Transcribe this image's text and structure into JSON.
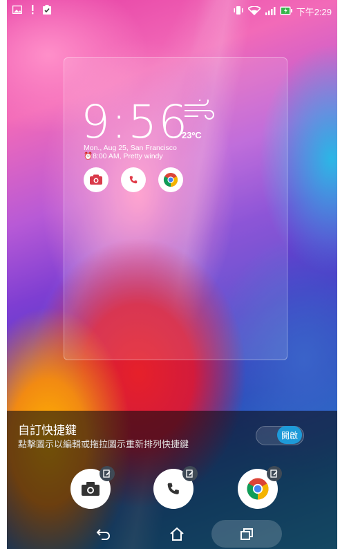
{
  "status_bar": {
    "left_icons": [
      "image-notification-icon",
      "alert-icon",
      "clipboard-check-icon"
    ],
    "right_icons": [
      "vibrate-icon",
      "wifi-icon",
      "signal-icon",
      "battery-charging-icon"
    ],
    "time": "下午2:29"
  },
  "widget": {
    "time": "9:56",
    "temperature": "23ºC",
    "date_line": "Mon., Aug 25, San Francisco",
    "alarm_line": "8:00 AM, Pretty windy",
    "weather_icon": "windy-icon",
    "apps": [
      "camera-icon",
      "phone-icon",
      "chrome-icon"
    ]
  },
  "panel": {
    "title": "自訂快捷鍵",
    "subtitle": "點擊圖示以編輯或拖拉圖示重新排列快捷鍵",
    "toggle_label": "開啟",
    "toggle_state": "on",
    "shortcuts": [
      {
        "name": "camera",
        "icon": "camera-icon"
      },
      {
        "name": "phone",
        "icon": "phone-icon"
      },
      {
        "name": "chrome",
        "icon": "chrome-icon"
      }
    ]
  },
  "navbar": {
    "buttons": [
      "back-icon",
      "home-icon",
      "recent-apps-icon"
    ]
  },
  "colors": {
    "accent": "#1e9ad8",
    "camera_red": "#d93a4a",
    "phone_red": "#e03a47"
  }
}
